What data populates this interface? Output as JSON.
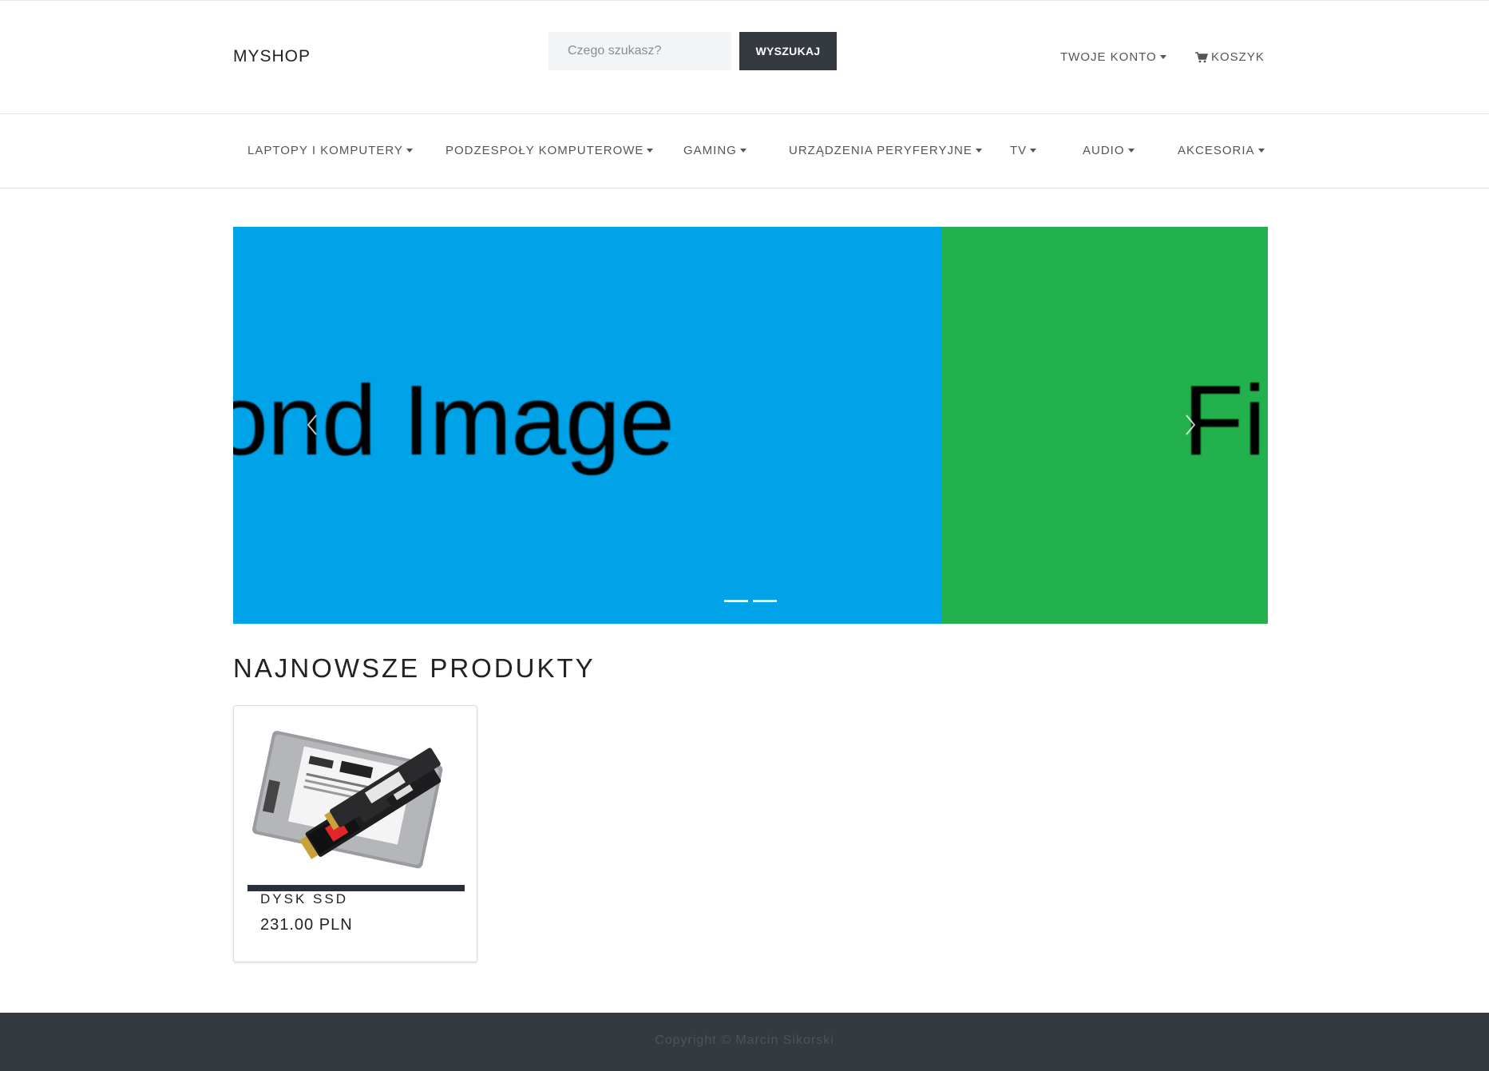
{
  "header": {
    "brand": "MYSHOP",
    "search_placeholder": "Czego szukasz?",
    "search_button": "WYSZUKAJ",
    "account_label": "TWOJE KONTO",
    "cart_label": "KOSZYK"
  },
  "nav": {
    "items": [
      {
        "label": "LAPTOPY I KOMPUTERY"
      },
      {
        "label": "PODZESPOŁY KOMPUTEROWE"
      },
      {
        "label": "GAMING"
      },
      {
        "label": "URZĄDZENIA PERYFERYJNE"
      },
      {
        "label": "TV"
      },
      {
        "label": "AUDIO"
      },
      {
        "label": "AKCESORIA"
      }
    ]
  },
  "carousel": {
    "slide_a_text": "cond Image",
    "slide_b_text": "Fi",
    "slide_a_color": "#00a2e8",
    "slide_b_color": "#22b14c",
    "indicator_count": 2
  },
  "products": {
    "section_title": "NAJNOWSZE PRODUKTY",
    "items": [
      {
        "name": "DYSK SSD",
        "price": "231.00 PLN"
      }
    ]
  },
  "footer": {
    "copyright": "Copyright © Marcin Sikorski"
  },
  "colors": {
    "dark": "#343a40",
    "search_bg": "#f3f4f6"
  }
}
